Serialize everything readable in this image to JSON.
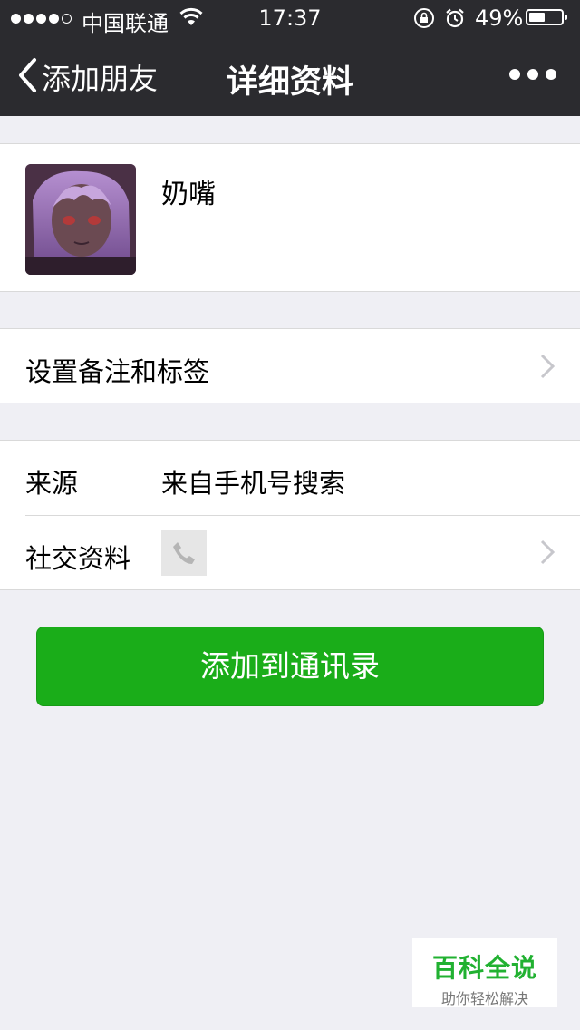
{
  "status_bar": {
    "carrier": "中国联通",
    "time": "17:37",
    "battery": "49%",
    "battery_level": 0.49,
    "signal_bars": 4,
    "signal_total": 5
  },
  "nav": {
    "back_label": "添加朋友",
    "title": "详细资料"
  },
  "profile": {
    "name": "奶嘴"
  },
  "remark_row": {
    "label": "设置备注和标签"
  },
  "info": {
    "source_label": "来源",
    "source_value": "来自手机号搜索",
    "social_label": "社交资料"
  },
  "add_button": {
    "label": "添加到通讯录"
  },
  "watermark": {
    "title": "百科全说",
    "subtitle": "助你轻松解决"
  },
  "colors": {
    "nav_bg": "#2b2b2f",
    "background": "#efeff4",
    "primary_green": "#1aad19"
  }
}
